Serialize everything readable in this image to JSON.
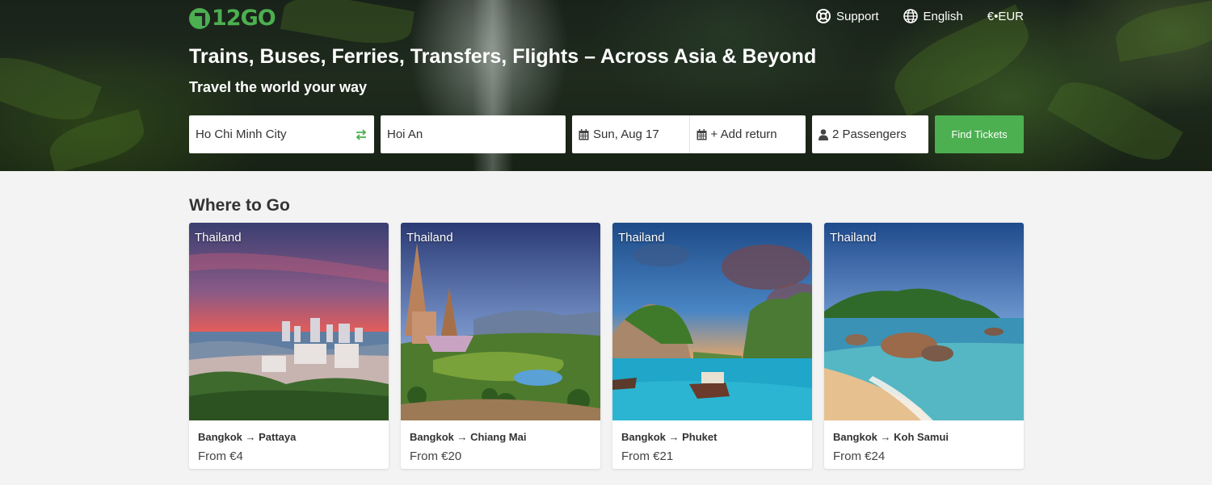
{
  "brand": {
    "name": "12GO",
    "color": "#4caf50"
  },
  "nav": {
    "support": "Support",
    "language": "English",
    "currency": "€•EUR"
  },
  "hero": {
    "title": "Trains, Buses, Ferries, Transfers, Flights – Across Asia & Beyond",
    "subtitle": "Travel the world your way"
  },
  "search": {
    "from": "Ho Chi Minh City",
    "to": "Hoi An",
    "date": "Sun, Aug 17",
    "return": "+ Add return",
    "passengers": "2 Passengers",
    "submit": "Find Tickets"
  },
  "section": {
    "title": "Where to Go"
  },
  "cards": [
    {
      "country": "Thailand",
      "route": "Bangkok → Pattaya",
      "price": "From €4"
    },
    {
      "country": "Thailand",
      "route": "Bangkok → Chiang Mai",
      "price": "From €20"
    },
    {
      "country": "Thailand",
      "route": "Bangkok → Phuket",
      "price": "From €21"
    },
    {
      "country": "Thailand",
      "route": "Bangkok → Koh Samui",
      "price": "From €24"
    }
  ]
}
